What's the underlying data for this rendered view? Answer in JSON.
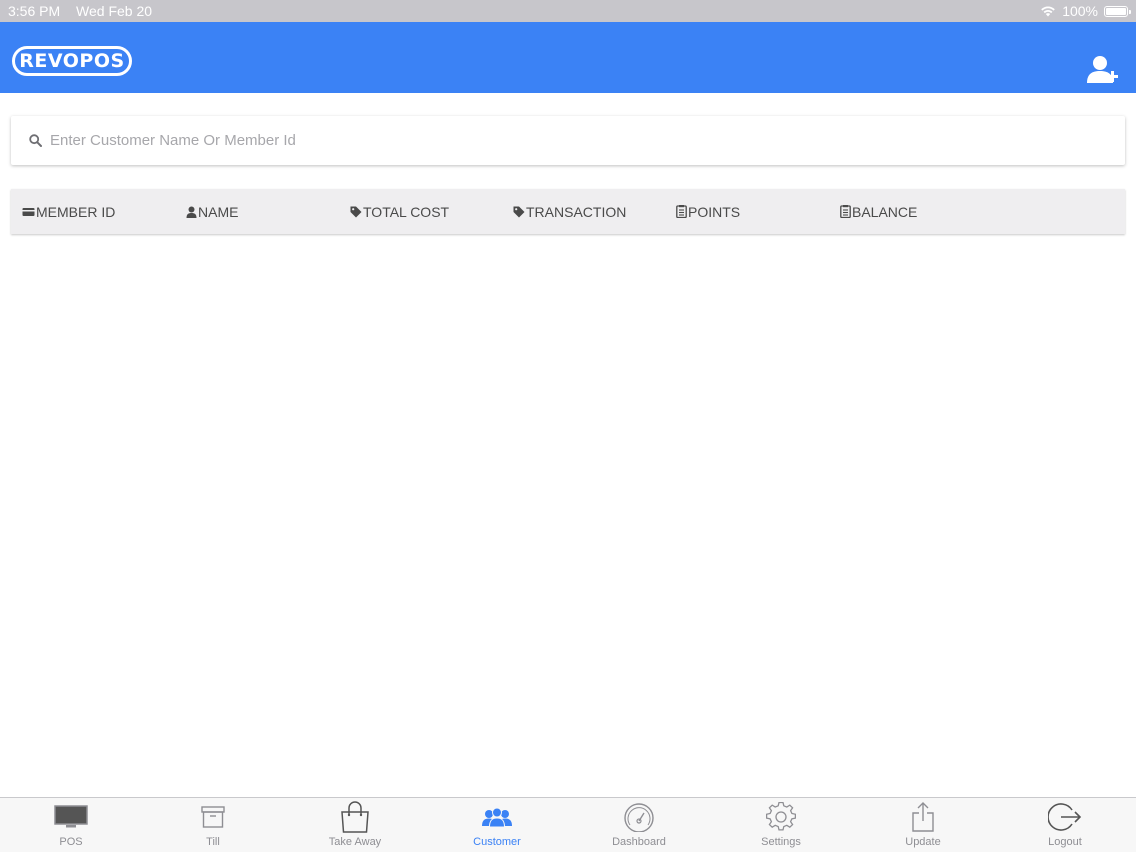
{
  "status_bar": {
    "time": "3:56 PM",
    "date": "Wed Feb 20",
    "battery": "100%"
  },
  "app": {
    "logo_text": "REVOPOS",
    "accent_color": "#3b82f5"
  },
  "search": {
    "placeholder": "Enter Customer Name Or Member Id",
    "value": ""
  },
  "table": {
    "columns": [
      {
        "label": "MEMBER ID",
        "icon": "card-icon"
      },
      {
        "label": "NAME",
        "icon": "person-icon"
      },
      {
        "label": "TOTAL COST",
        "icon": "tag-icon"
      },
      {
        "label": "TRANSACTION",
        "icon": "tag-icon"
      },
      {
        "label": "POINTS",
        "icon": "clipboard-icon"
      },
      {
        "label": "BALANCE",
        "icon": "clipboard-icon"
      }
    ],
    "rows": []
  },
  "tabs": [
    {
      "label": "POS",
      "icon": "monitor-icon",
      "active": false
    },
    {
      "label": "Till",
      "icon": "archive-icon",
      "active": false
    },
    {
      "label": "Take Away",
      "icon": "bag-icon",
      "active": false
    },
    {
      "label": "Customer",
      "icon": "users-icon",
      "active": true
    },
    {
      "label": "Dashboard",
      "icon": "speedometer-icon",
      "active": false
    },
    {
      "label": "Settings",
      "icon": "gear-icon",
      "active": false
    },
    {
      "label": "Update",
      "icon": "share-icon",
      "active": false
    },
    {
      "label": "Logout",
      "icon": "logout-icon",
      "active": false
    }
  ]
}
